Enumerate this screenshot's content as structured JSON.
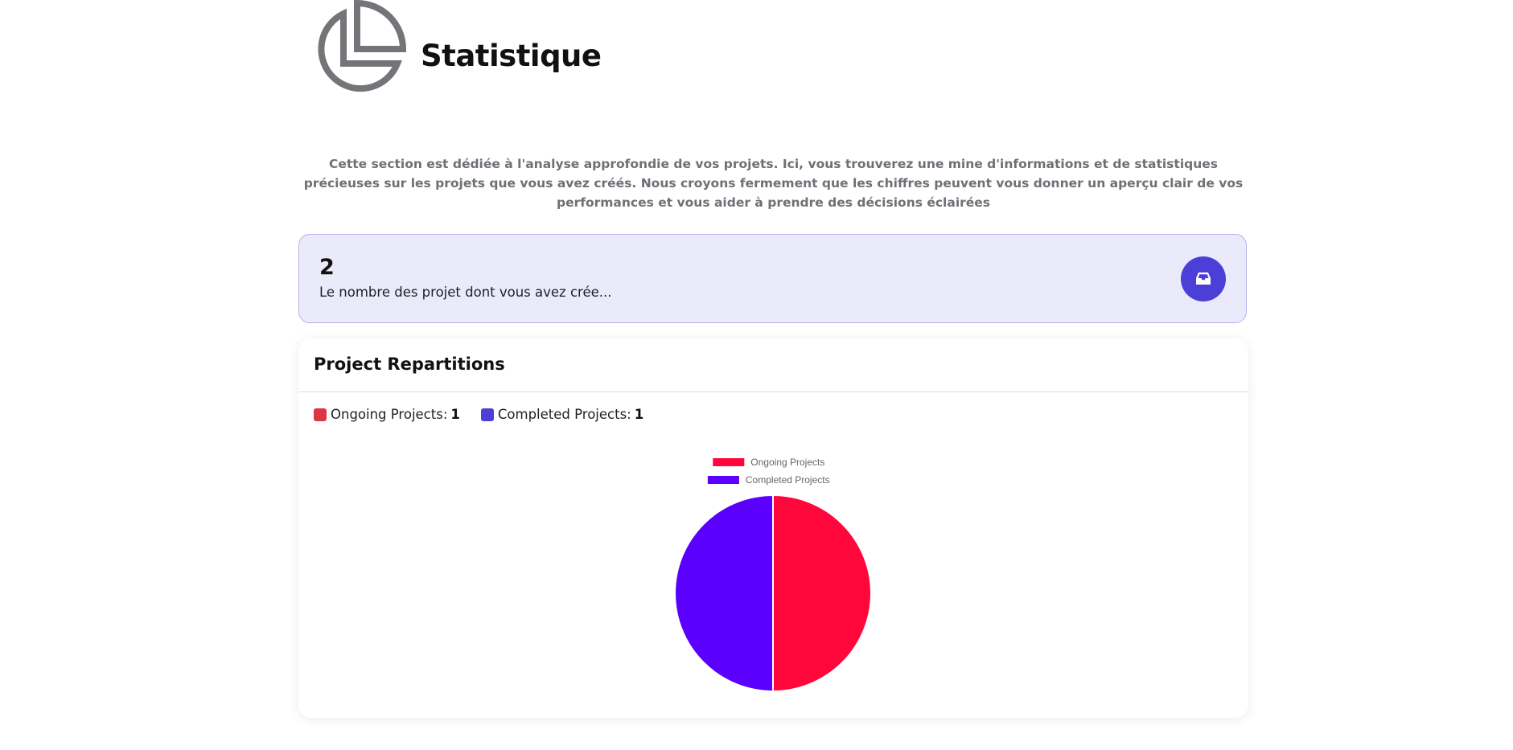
{
  "header": {
    "title": "Statistique",
    "logo_icon": "pie-chart-icon",
    "icon_color": "#757579"
  },
  "description": "Cette section est dédiée à l'analyse approfondie de vos projets. Ici, vous trouverez une mine d'informations et de statistiques précieuses sur les projets que vous avez créés. Nous croyons fermement que les chiffres peuvent vous donner un aperçu clair de vos performances et vous aider à prendre des décisions éclairées",
  "stat_card": {
    "value": "2",
    "label": "Le nombre des projet dont vous avez crée...",
    "icon": "inbox-icon",
    "accent": "#4b3fd8"
  },
  "panel": {
    "title": "Project Repartitions",
    "summary": [
      {
        "label": "Ongoing Projects:",
        "count": "1",
        "color": "#dc3545"
      },
      {
        "label": "Completed Projects:",
        "count": "1",
        "color": "#4b3fd8"
      }
    ]
  },
  "chart_data": {
    "type": "pie",
    "categories": [
      "Ongoing Projects",
      "Completed Projects"
    ],
    "values": [
      1,
      1
    ],
    "colors": [
      "#ff073a",
      "#5b00ff"
    ],
    "legend_position": "top"
  }
}
